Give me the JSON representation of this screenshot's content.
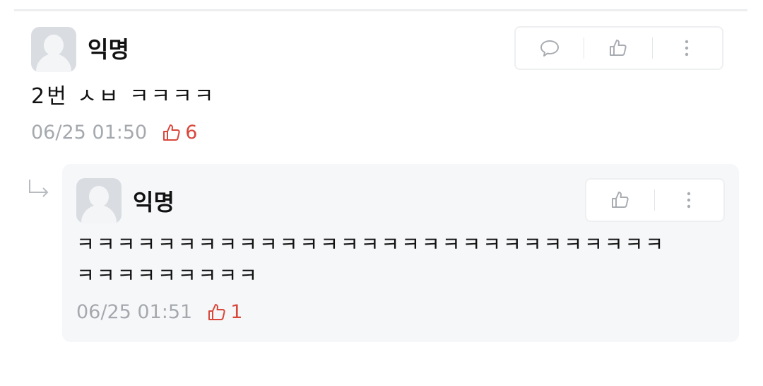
{
  "comment": {
    "author": "익명",
    "text": "2번 ㅅㅂ ㅋㅋㅋㅋ",
    "timestamp": "06/25 01:50",
    "like_count": "6",
    "icons": [
      "avatar-icon",
      "reply-icon",
      "thumbs-up-icon",
      "more-vertical-icon"
    ]
  },
  "reply": {
    "author": "익명",
    "text_line1": "ㅋㅋㅋㅋㅋㅋㅋㅋㅋㅋㅋㅋㅋㅋㅋㅋㅋㅋㅋㅋㅋㅋㅋㅋㅋㅋㅋㅋㅋ",
    "text_line2": "ㅋㅋㅋㅋㅋㅋㅋㅋㅋ",
    "timestamp": "06/25 01:51",
    "like_count": "1",
    "icons": [
      "reply-arrow-icon",
      "avatar-icon",
      "thumbs-up-icon",
      "more-vertical-icon"
    ]
  },
  "colors": {
    "like_accent": "#d9473b",
    "meta_gray": "#a5a9ae",
    "reply_background": "#f6f7f9",
    "avatar_gray": "#d9dde2"
  }
}
